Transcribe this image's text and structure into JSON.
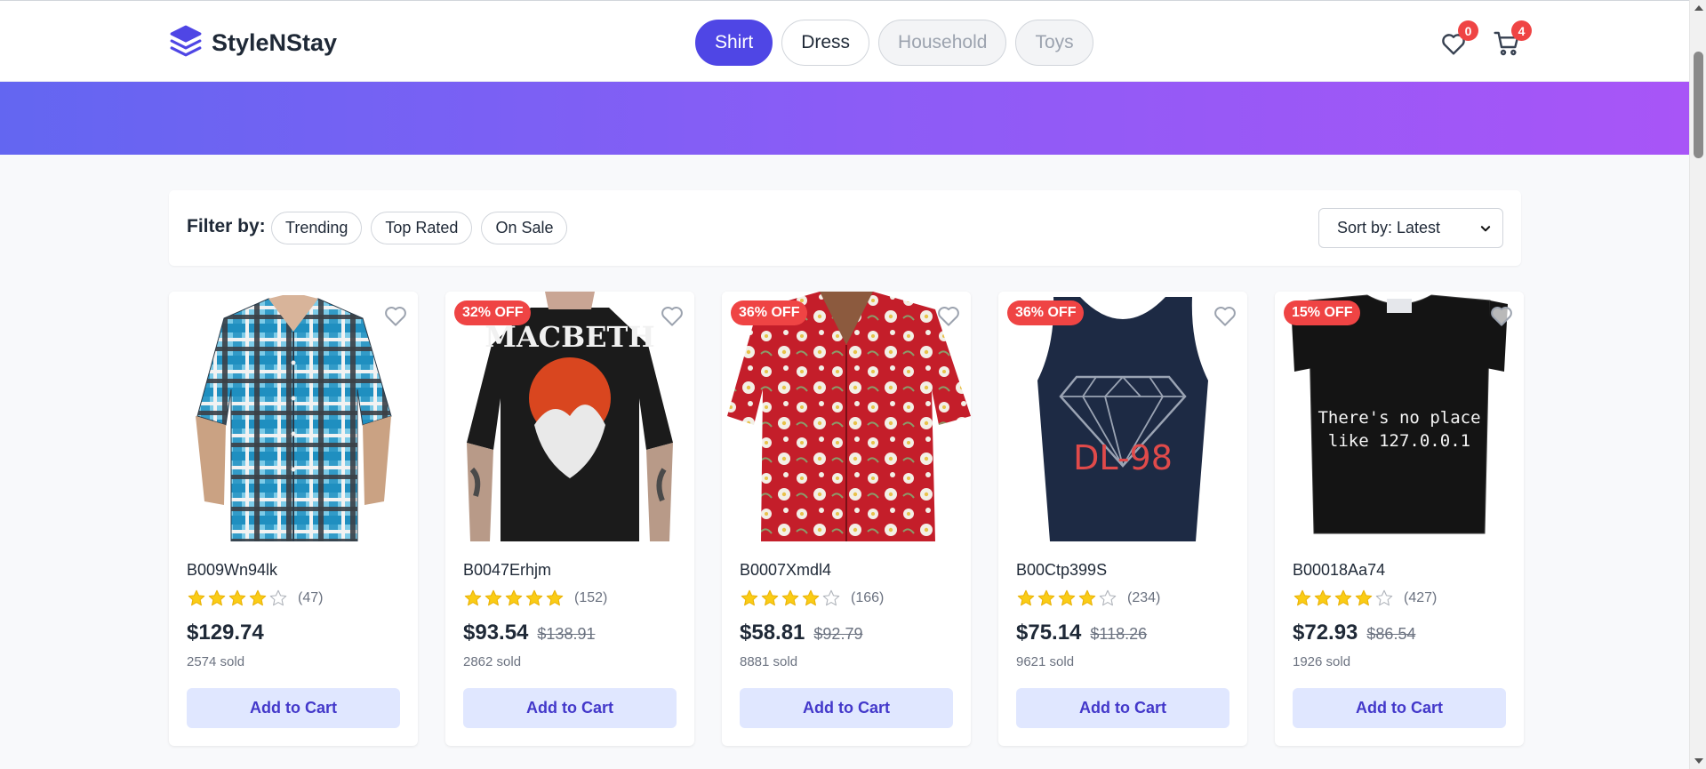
{
  "header": {
    "brand": "StyleNStay",
    "nav": [
      {
        "label": "Shirt",
        "state": "active"
      },
      {
        "label": "Dress",
        "state": "normal"
      },
      {
        "label": "Household",
        "state": "disabled"
      },
      {
        "label": "Toys",
        "state": "disabled"
      }
    ],
    "wishlist_count": "0",
    "cart_count": "4"
  },
  "filters": {
    "label": "Filter by:",
    "chips": [
      "Trending",
      "Top Rated",
      "On Sale"
    ],
    "sort_value": "Sort by: Latest"
  },
  "products": [
    {
      "sku": "B009Wn94lk",
      "rating": 4,
      "reviews": "(47)",
      "price": "$129.74",
      "old_price": "",
      "sold": "2574 sold",
      "discount": "",
      "button": "Add to Cart",
      "image": "plaid-shirt"
    },
    {
      "sku": "B0047Erhjm",
      "rating": 5,
      "reviews": "(152)",
      "price": "$93.54",
      "old_price": "$138.91",
      "sold": "2862 sold",
      "discount": "32% OFF",
      "button": "Add to Cart",
      "image": "macbeth-tshirt",
      "image_text": "MACBETH"
    },
    {
      "sku": "B0007Xmdl4",
      "rating": 4,
      "reviews": "(166)",
      "price": "$58.81",
      "old_price": "$92.79",
      "sold": "8881 sold",
      "discount": "36% OFF",
      "button": "Add to Cart",
      "image": "hawaiian-shirt"
    },
    {
      "sku": "B00Ctp399S",
      "rating": 4,
      "reviews": "(234)",
      "price": "$75.14",
      "old_price": "$118.26",
      "sold": "9621 sold",
      "discount": "36% OFF",
      "button": "Add to Cart",
      "image": "diamond-tank-top",
      "image_text": "DL-98"
    },
    {
      "sku": "B00018Aa74",
      "rating": 4,
      "reviews": "(427)",
      "price": "$72.93",
      "old_price": "$86.54",
      "sold": "1926 sold",
      "discount": "15% OFF",
      "button": "Add to Cart",
      "image": "localhost-tshirt",
      "image_text_1": "There's no place",
      "image_text_2": "like 127.0.0.1"
    }
  ],
  "colors": {
    "accent": "#4f46e5",
    "badge": "#ef4444",
    "star": "#facc15",
    "button_bg": "#e0e7ff"
  }
}
